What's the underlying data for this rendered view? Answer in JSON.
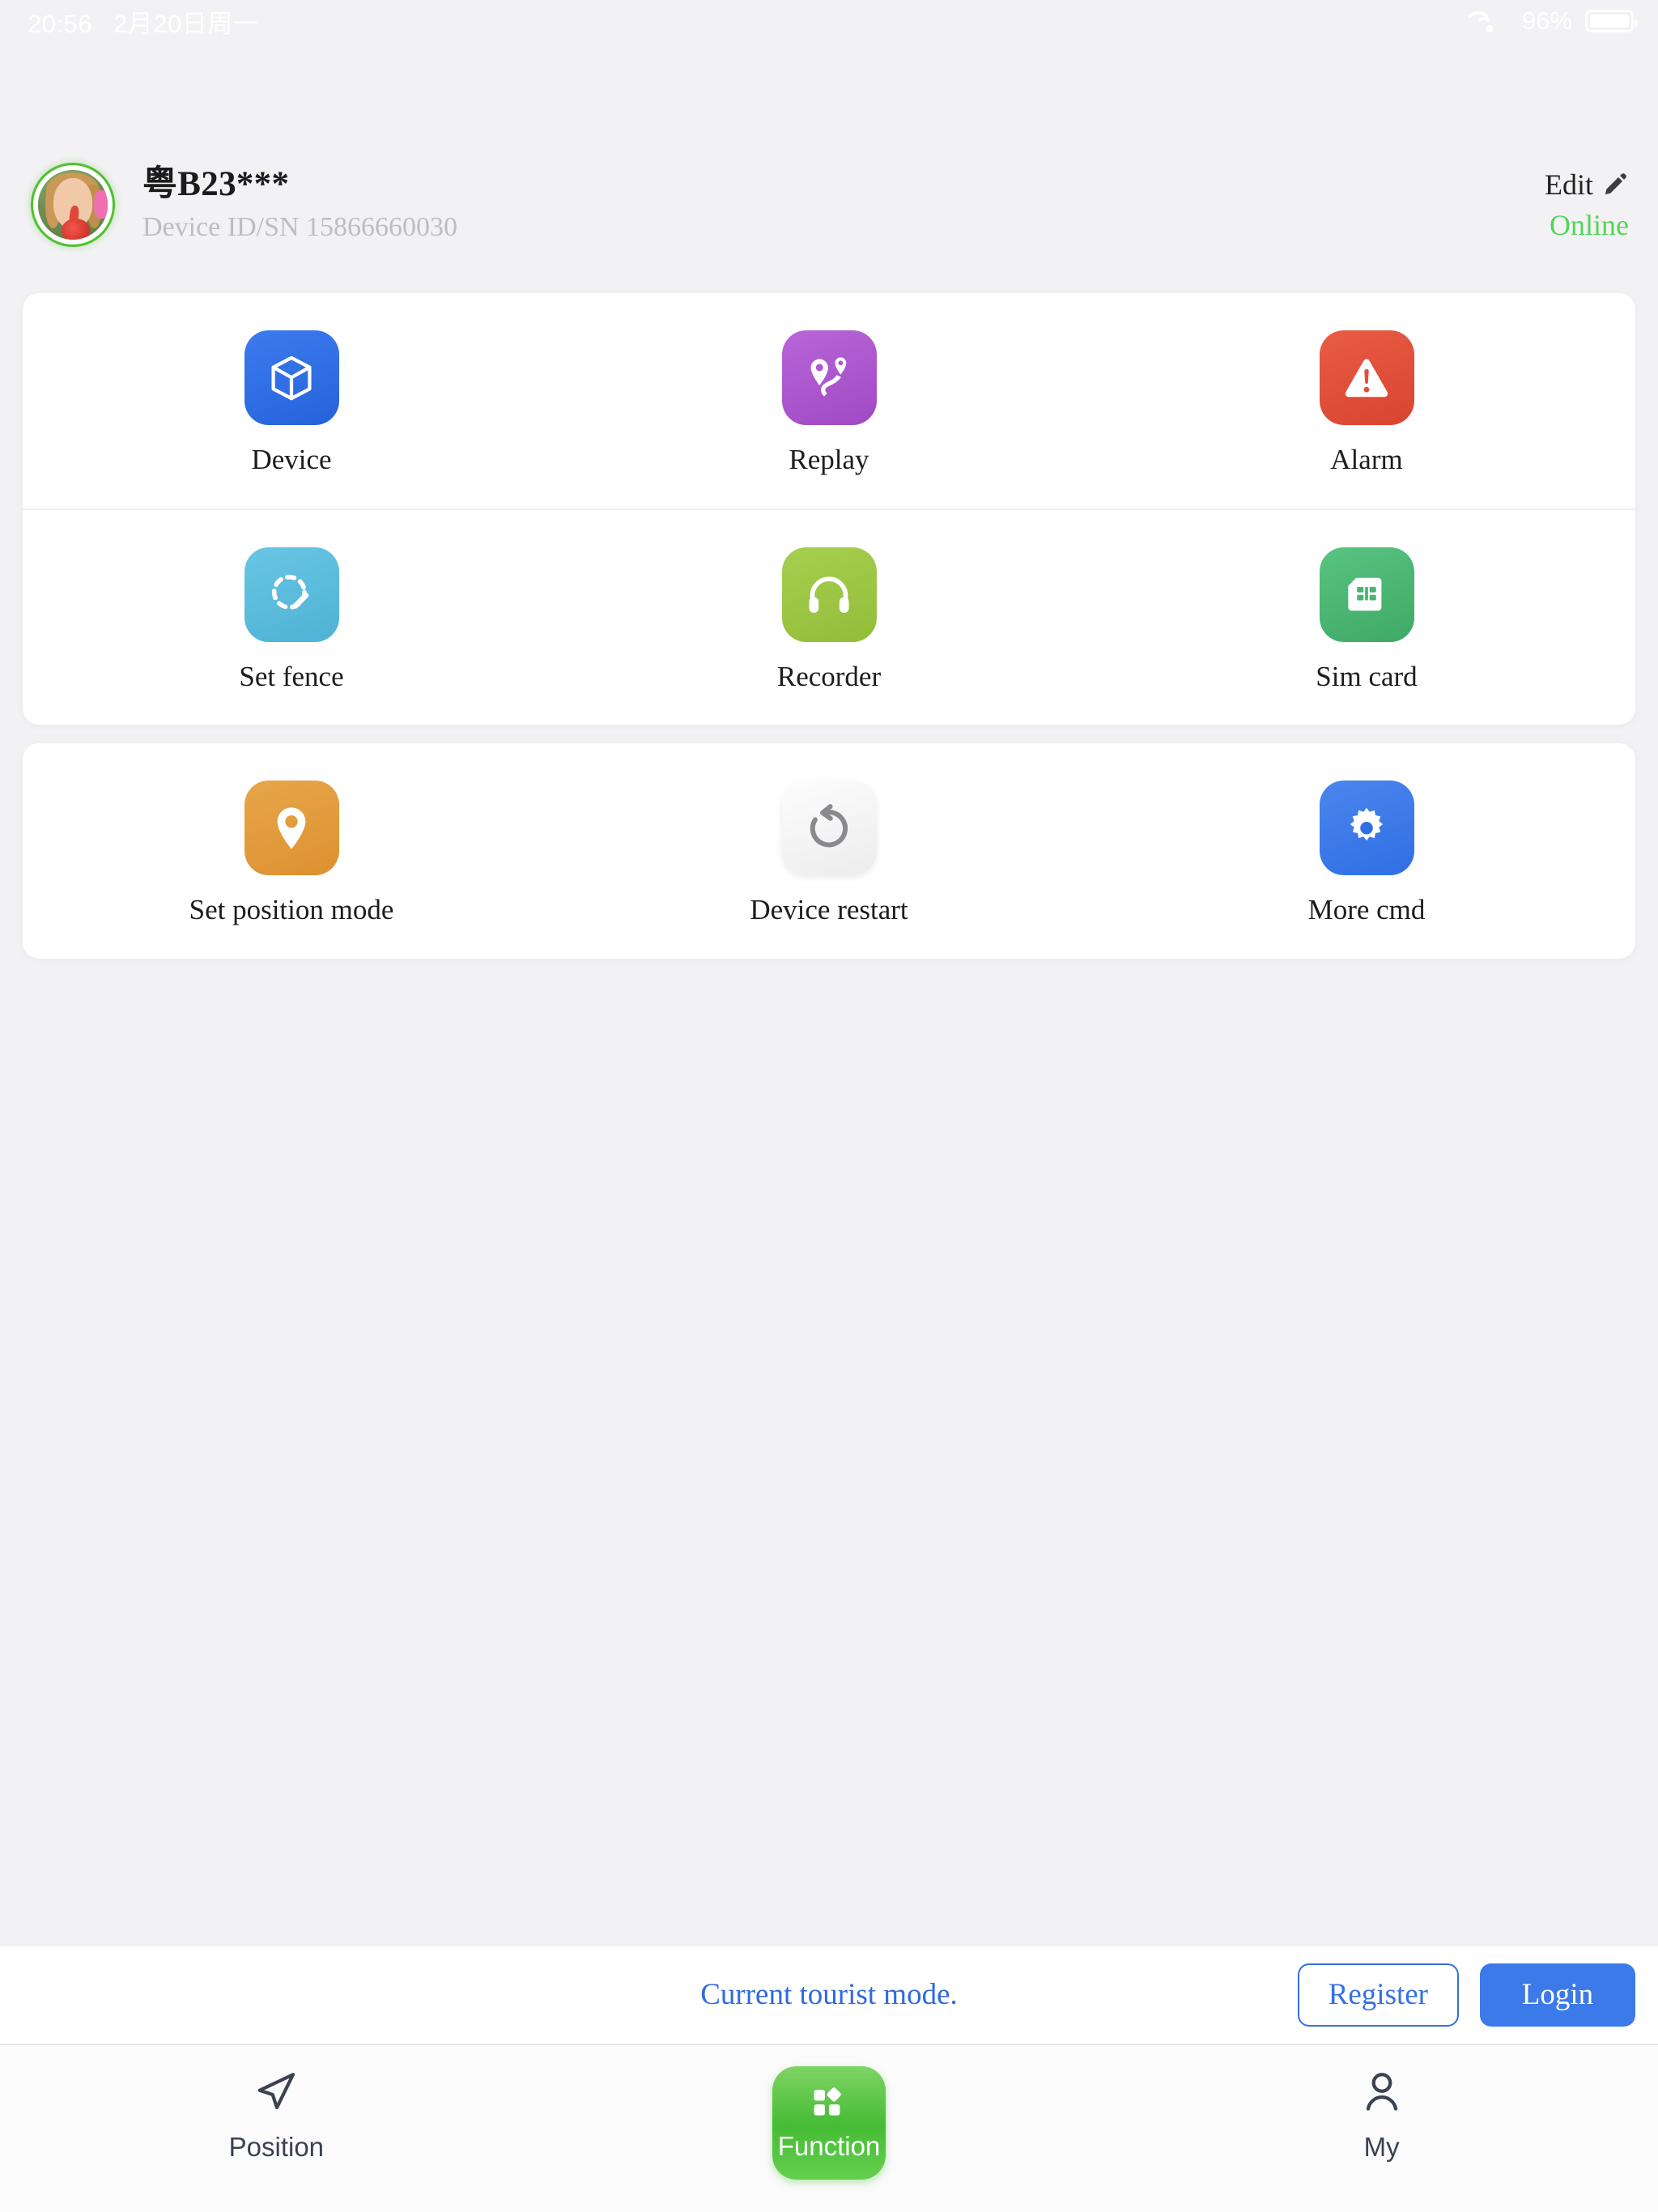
{
  "status_bar": {
    "time": "20:56",
    "date": "2月20日周一",
    "wifi_icon": "wifi-icon",
    "battery_percent": "96%",
    "battery_icon": "battery-icon"
  },
  "device_header": {
    "avatar_icon": "avatar",
    "name": "粤B23***",
    "sn_label": "Device ID/SN 15866660030",
    "edit_label": "Edit",
    "edit_icon": "pencil-icon",
    "status_label": "Online",
    "status_color": "#53d45a"
  },
  "cards": [
    {
      "name": "main-functions",
      "rows": [
        [
          {
            "label": "Device",
            "icon": "cube-icon",
            "color": "#2f6fe4"
          },
          {
            "label": "Replay",
            "icon": "route-pins-icon",
            "color": "#ad57cf"
          },
          {
            "label": "Alarm",
            "icon": "warning-icon",
            "color": "#e2503c"
          }
        ],
        [
          {
            "label": "Set fence",
            "icon": "dashed-circle-pencil-icon",
            "color": "#5bbcdc"
          },
          {
            "label": "Recorder",
            "icon": "headphones-icon",
            "color": "#9cc543"
          },
          {
            "label": "Sim card",
            "icon": "sim-card-icon",
            "color": "#4bb472"
          }
        ]
      ]
    },
    {
      "name": "extra-commands",
      "rows": [
        [
          {
            "label": "Set position mode",
            "icon": "map-pin-icon",
            "color": "#e19a38"
          },
          {
            "label": "Device restart",
            "icon": "restart-icon",
            "color": "#f4f4f5"
          },
          {
            "label": "More cmd",
            "icon": "gear-icon",
            "color": "#3b7ae8"
          }
        ]
      ]
    }
  ],
  "tourist_bar": {
    "message": "Current tourist mode.",
    "register_label": "Register",
    "login_label": "Login"
  },
  "tab_bar": {
    "tabs": [
      {
        "label": "Position",
        "icon": "navigation-arrow-icon",
        "active": false
      },
      {
        "label": "Function",
        "icon": "grid-squares-icon",
        "active": true
      },
      {
        "label": "My",
        "icon": "person-icon",
        "active": false
      }
    ]
  }
}
